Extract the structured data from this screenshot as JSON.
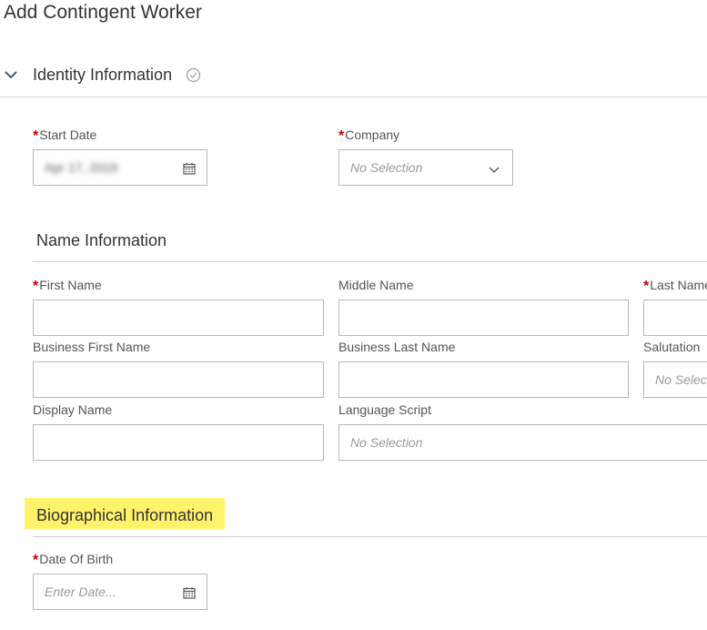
{
  "page": {
    "title": "Add Contingent Worker"
  },
  "identity_section": {
    "title": "Identity Information",
    "start_date": {
      "label": "Start Date",
      "value": "Apr 17, 2019"
    },
    "company": {
      "label": "Company",
      "value": "No Selection"
    }
  },
  "name_section": {
    "title": "Name Information",
    "first_name": {
      "label": "First Name",
      "value": ""
    },
    "middle_name": {
      "label": "Middle Name",
      "value": ""
    },
    "last_name": {
      "label": "Last Name",
      "value": ""
    },
    "business_first_name": {
      "label": "Business First Name",
      "value": ""
    },
    "business_last_name": {
      "label": "Business Last Name",
      "value": ""
    },
    "salutation": {
      "label": "Salutation",
      "value": "No Selection"
    },
    "display_name": {
      "label": "Display Name",
      "value": ""
    },
    "language_script": {
      "label": "Language Script",
      "value": "No Selection"
    }
  },
  "bio_section": {
    "title": "Biographical Information",
    "date_of_birth": {
      "label": "Date Of Birth",
      "placeholder": "Enter Date..."
    }
  },
  "colors": {
    "required": "#c40000",
    "highlight": "#fff36b",
    "border": "#b8b8b8"
  }
}
